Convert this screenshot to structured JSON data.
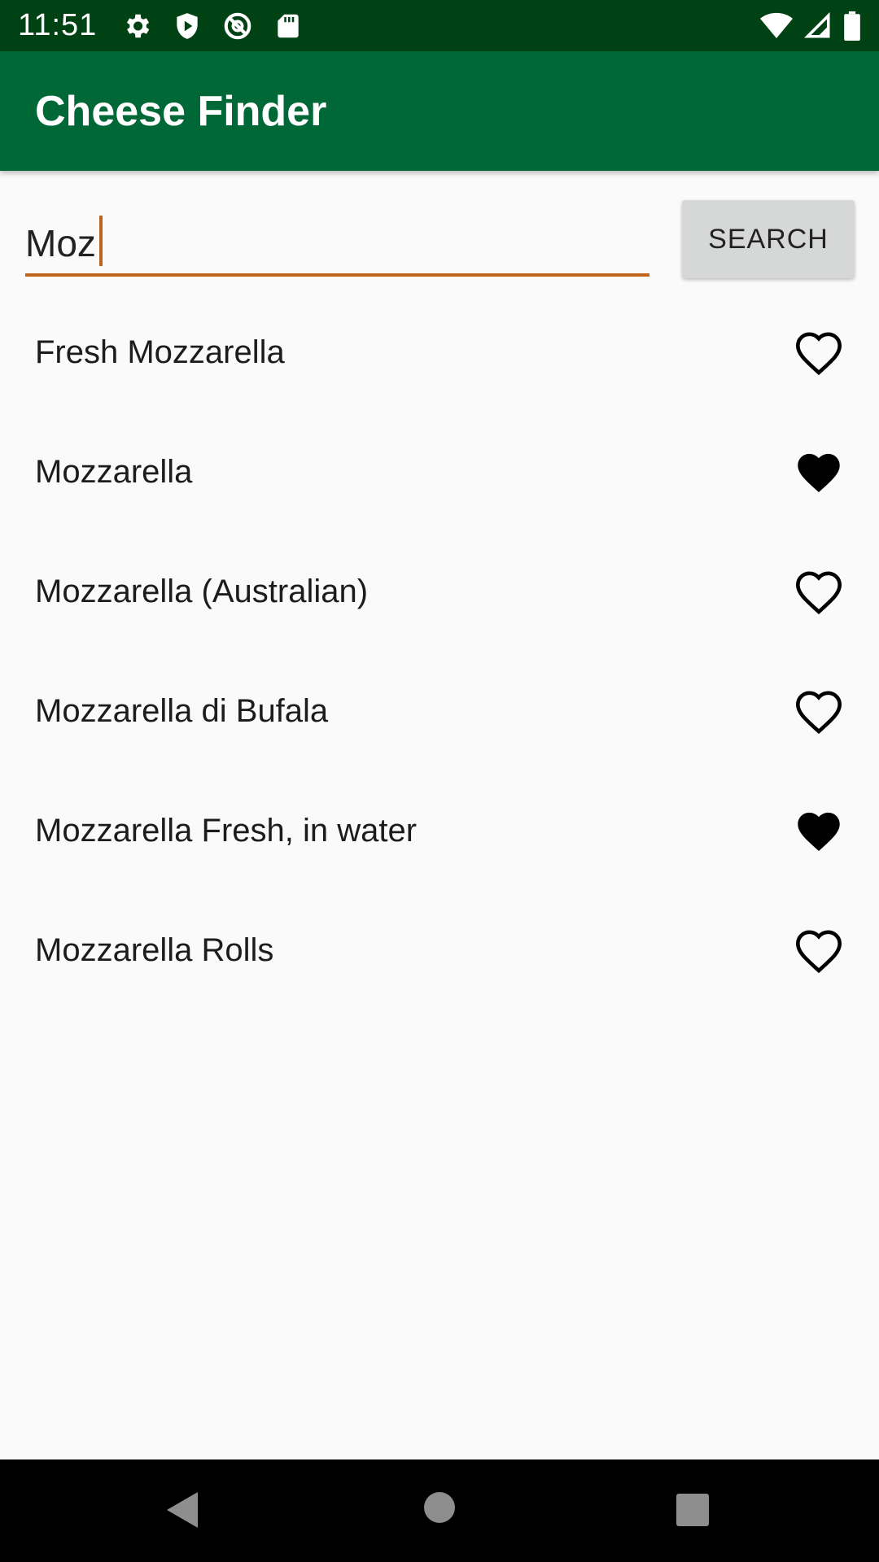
{
  "status_bar": {
    "time": "11:51",
    "left_icons": [
      "settings-icon",
      "shield-icon",
      "at-sign-icon",
      "sd-card-icon"
    ],
    "right_icons": [
      "wifi-icon",
      "signal-icon",
      "battery-icon"
    ]
  },
  "app_bar": {
    "title": "Cheese Finder"
  },
  "search": {
    "value": "Moz",
    "button_label": "SEARCH"
  },
  "results": [
    {
      "name": "Fresh Mozzarella",
      "favorite": false
    },
    {
      "name": "Mozzarella",
      "favorite": true
    },
    {
      "name": "Mozzarella (Australian)",
      "favorite": false
    },
    {
      "name": "Mozzarella di Bufala",
      "favorite": false
    },
    {
      "name": "Mozzarella Fresh, in water",
      "favorite": true
    },
    {
      "name": "Mozzarella Rolls",
      "favorite": false
    }
  ],
  "nav_bar": {
    "buttons": [
      "back-icon",
      "home-icon",
      "recents-icon"
    ]
  },
  "colors": {
    "status_bar": "#004214",
    "app_bar": "#006837",
    "accent": "#c0631b",
    "button_bg": "#d6d7d7",
    "background": "#fafafa"
  }
}
